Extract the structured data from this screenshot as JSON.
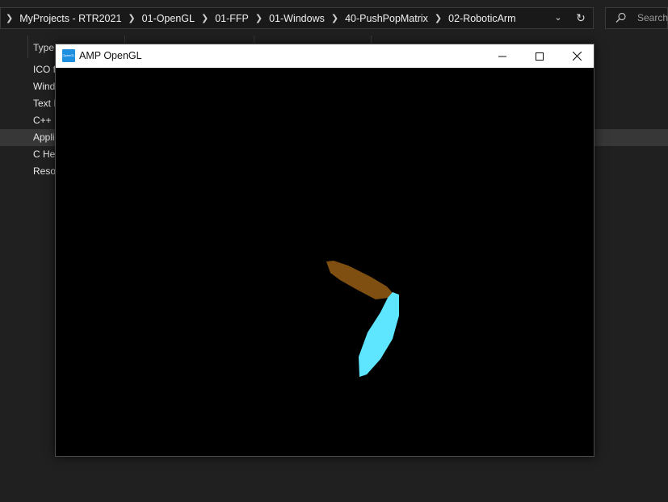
{
  "explorer": {
    "breadcrumbs": [
      "MyProjects - RTR2021",
      "01-OpenGL",
      "01-FFP",
      "01-Windows",
      "40-PushPopMatrix",
      "02-RoboticArm"
    ],
    "search": {
      "placeholder": "Search"
    },
    "column_header": {
      "type_label": "Type"
    },
    "file_types": [
      "ICO f",
      "Wind",
      "Text I",
      "C++",
      "Appli",
      "C He",
      "Resou"
    ],
    "selected_index": 4
  },
  "app_window": {
    "title": "AMP OpenGL",
    "icon_text": "OpenGL",
    "scene": {
      "arm_upper_color": "#7f4f12",
      "arm_lower_color": "#5ee5ff",
      "background_color": "#000000"
    }
  }
}
